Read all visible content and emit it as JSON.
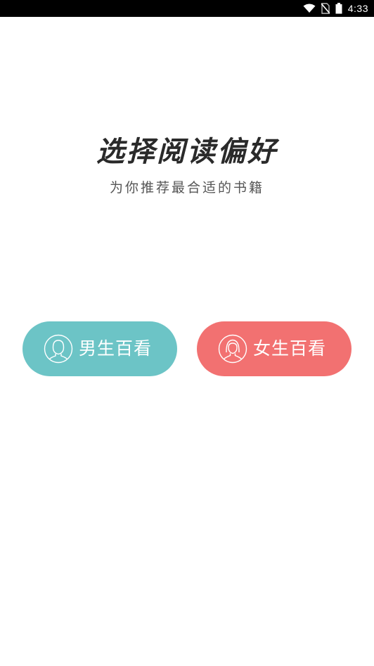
{
  "status_bar": {
    "time": "4:33",
    "icons": [
      "wifi-icon",
      "no-sim-icon",
      "battery-icon"
    ]
  },
  "header": {
    "title": "选择阅读偏好",
    "subtitle": "为你推荐最合适的书籍"
  },
  "choices": {
    "male": {
      "label": "男生百看",
      "icon": "male-avatar-icon",
      "color": "#6cc4c6"
    },
    "female": {
      "label": "女生百看",
      "icon": "female-avatar-icon",
      "color": "#f27171"
    }
  }
}
